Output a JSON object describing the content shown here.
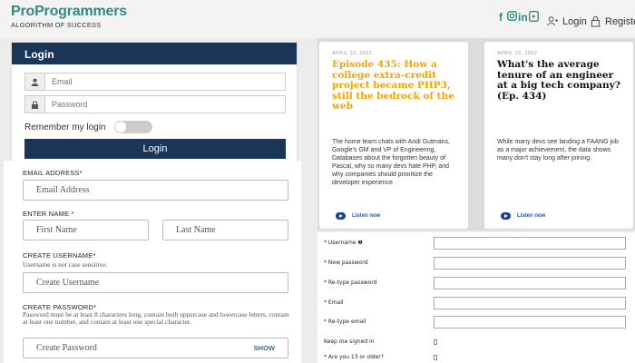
{
  "header": {
    "brand_name": "ProProgrammers",
    "brand_tagline": "ALGORITHM OF SUCCESS",
    "social_icons": [
      "facebook-icon",
      "instagram-icon",
      "linkedin-icon",
      "youtube-icon"
    ],
    "login_label": "Login",
    "register_label": "Register",
    "accent_color": "#2e8b7e"
  },
  "login": {
    "title": "Login",
    "email_placeholder": "Email",
    "password_placeholder": "Password",
    "remember_label": "Remember my login",
    "button_label": "Login",
    "header_color": "#1b3558"
  },
  "signup": {
    "email_label": "EMAIL ADDRESS",
    "email_placeholder": "Email Address",
    "name_label": "ENTER NAME",
    "first_name_placeholder": "First Name",
    "last_name_placeholder": "Last Name",
    "username_label": "CREATE USERNAME",
    "username_help": "Username is not case sensitive.",
    "username_placeholder": "Create Username",
    "password_label": "CREATE PASSWORD",
    "password_help": "Password must be at least 8 characters long, contain both uppercase and lowercase letters, contain at least one number, and contain at least one special character.",
    "password_placeholder": "Create Password",
    "show_label": "SHOW"
  },
  "articles": [
    {
      "date": "APRIL 22, 2022",
      "title": "Episode 435: How a college extra-credit project became PHP3, still the bedrock of the web",
      "title_color": "#f0a500",
      "description": "The home team chats with Andi Gutmans, Google's GM and VP of Engineering, Databases about the forgotten beauty of Pascal, why so many devs hate PHP, and why companies should prioritize the developer experience.",
      "listen_label": "Listen now"
    },
    {
      "date": "APRIL 19, 2022",
      "title": "What's the average tenure of an engineer at a big tech company? (Ep. 434)",
      "title_color": "#111111",
      "description": "While many devs see landing a FAANG job as a major achievement, the data shows many don't stay long after joining.",
      "listen_label": "Listen now"
    }
  ],
  "register": {
    "fields": [
      "* Username ❷",
      "* New password",
      "* Re-type password",
      "* Email",
      "* Re-type email"
    ],
    "keep_signed_label": "Keep me signed in",
    "age_label": "* Are you 13 or older?"
  }
}
